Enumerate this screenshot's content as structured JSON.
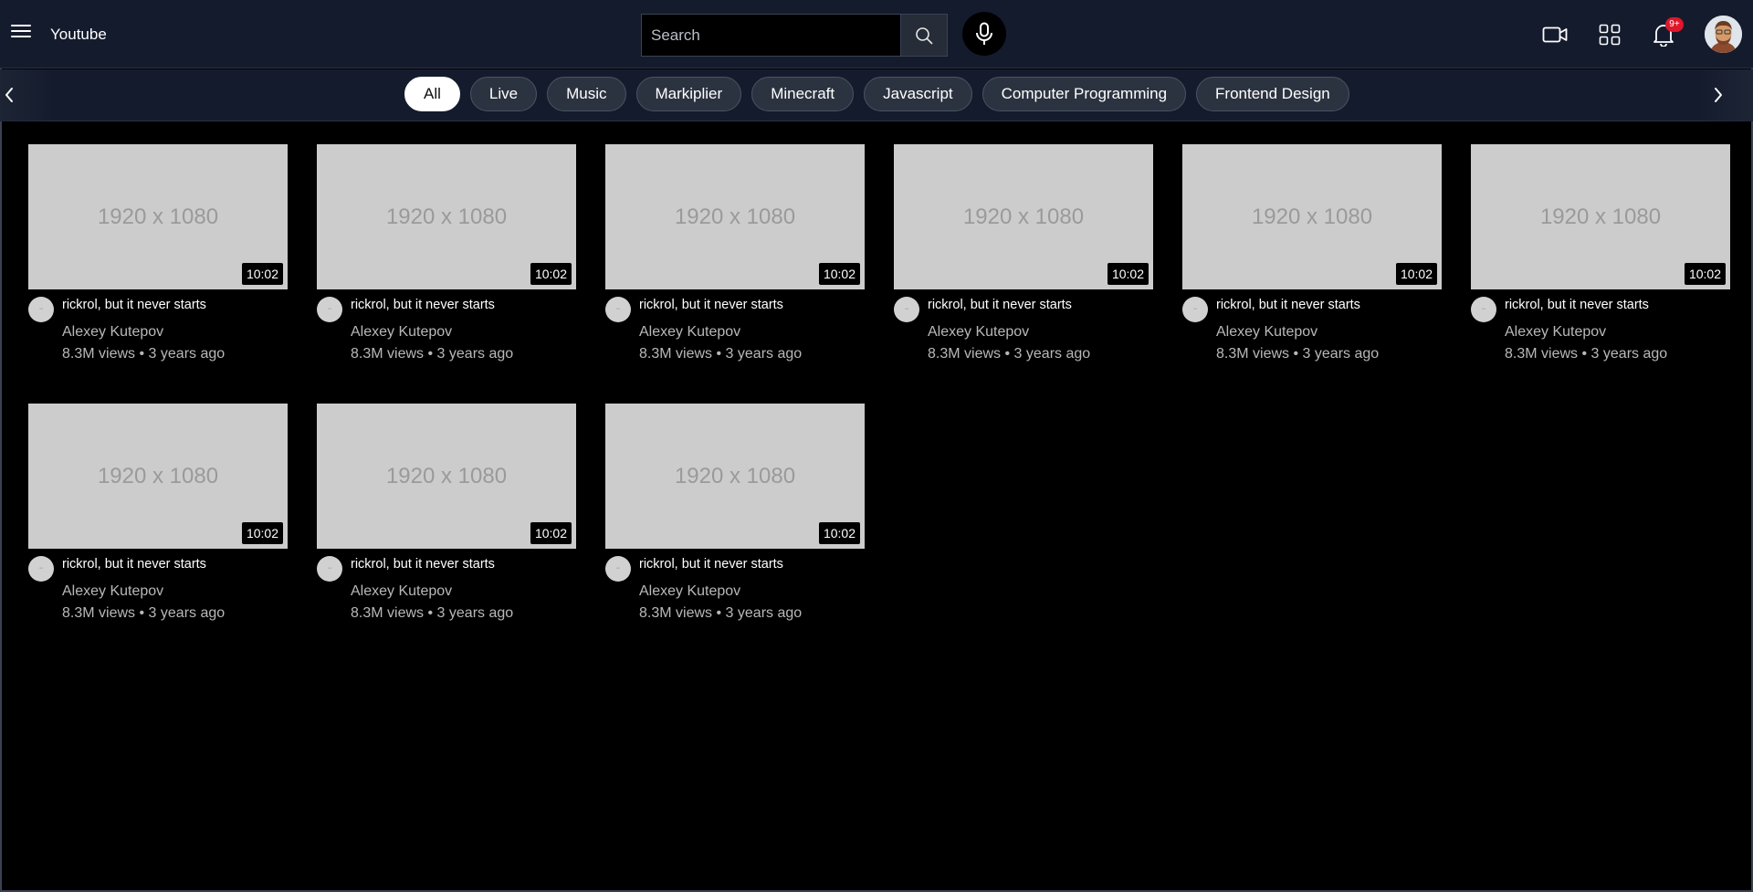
{
  "header": {
    "brand": "Youtube",
    "search_placeholder": "Search",
    "notification_badge": "9+"
  },
  "chips": [
    "All",
    "Live",
    "Music",
    "Markiplier",
    "Minecraft",
    "Javascript",
    "Computer Programming",
    "Frontend Design"
  ],
  "active_chip": "All",
  "videos": [
    {
      "thumb": "1920 x 1080",
      "duration": "10:02",
      "title": "rickrol, but it never starts",
      "channel": "Alexey Kutepov",
      "views": "8.3M views",
      "age": "3 years ago"
    },
    {
      "thumb": "1920 x 1080",
      "duration": "10:02",
      "title": "rickrol, but it never starts",
      "channel": "Alexey Kutepov",
      "views": "8.3M views",
      "age": "3 years ago"
    },
    {
      "thumb": "1920 x 1080",
      "duration": "10:02",
      "title": "rickrol, but it never starts",
      "channel": "Alexey Kutepov",
      "views": "8.3M views",
      "age": "3 years ago"
    },
    {
      "thumb": "1920 x 1080",
      "duration": "10:02",
      "title": "rickrol, but it never starts",
      "channel": "Alexey Kutepov",
      "views": "8.3M views",
      "age": "3 years ago"
    },
    {
      "thumb": "1920 x 1080",
      "duration": "10:02",
      "title": "rickrol, but it never starts",
      "channel": "Alexey Kutepov",
      "views": "8.3M views",
      "age": "3 years ago"
    },
    {
      "thumb": "1920 x 1080",
      "duration": "10:02",
      "title": "rickrol, but it never starts",
      "channel": "Alexey Kutepov",
      "views": "8.3M views",
      "age": "3 years ago"
    },
    {
      "thumb": "1920 x 1080",
      "duration": "10:02",
      "title": "rickrol, but it never starts",
      "channel": "Alexey Kutepov",
      "views": "8.3M views",
      "age": "3 years ago"
    },
    {
      "thumb": "1920 x 1080",
      "duration": "10:02",
      "title": "rickrol, but it never starts",
      "channel": "Alexey Kutepov",
      "views": "8.3M views",
      "age": "3 years ago"
    },
    {
      "thumb": "1920 x 1080",
      "duration": "10:02",
      "title": "rickrol, but it never starts",
      "channel": "Alexey Kutepov",
      "views": "8.3M views",
      "age": "3 years ago"
    }
  ],
  "meta_separator": "•",
  "icons": {
    "menu": "menu-icon",
    "search": "search-icon",
    "mic": "mic-icon",
    "camera": "video-camera-icon",
    "apps": "apps-grid-icon",
    "bell": "bell-icon",
    "chevron_left": "chevron-left-icon",
    "chevron_right": "chevron-right-icon"
  },
  "colors": {
    "header_bg": "#141b2d",
    "page_bg": "#000000",
    "chip_bg": "#2c3340",
    "chip_active_bg": "#ffffff",
    "badge": "#e0162b",
    "thumb_bg": "#cccccc"
  }
}
